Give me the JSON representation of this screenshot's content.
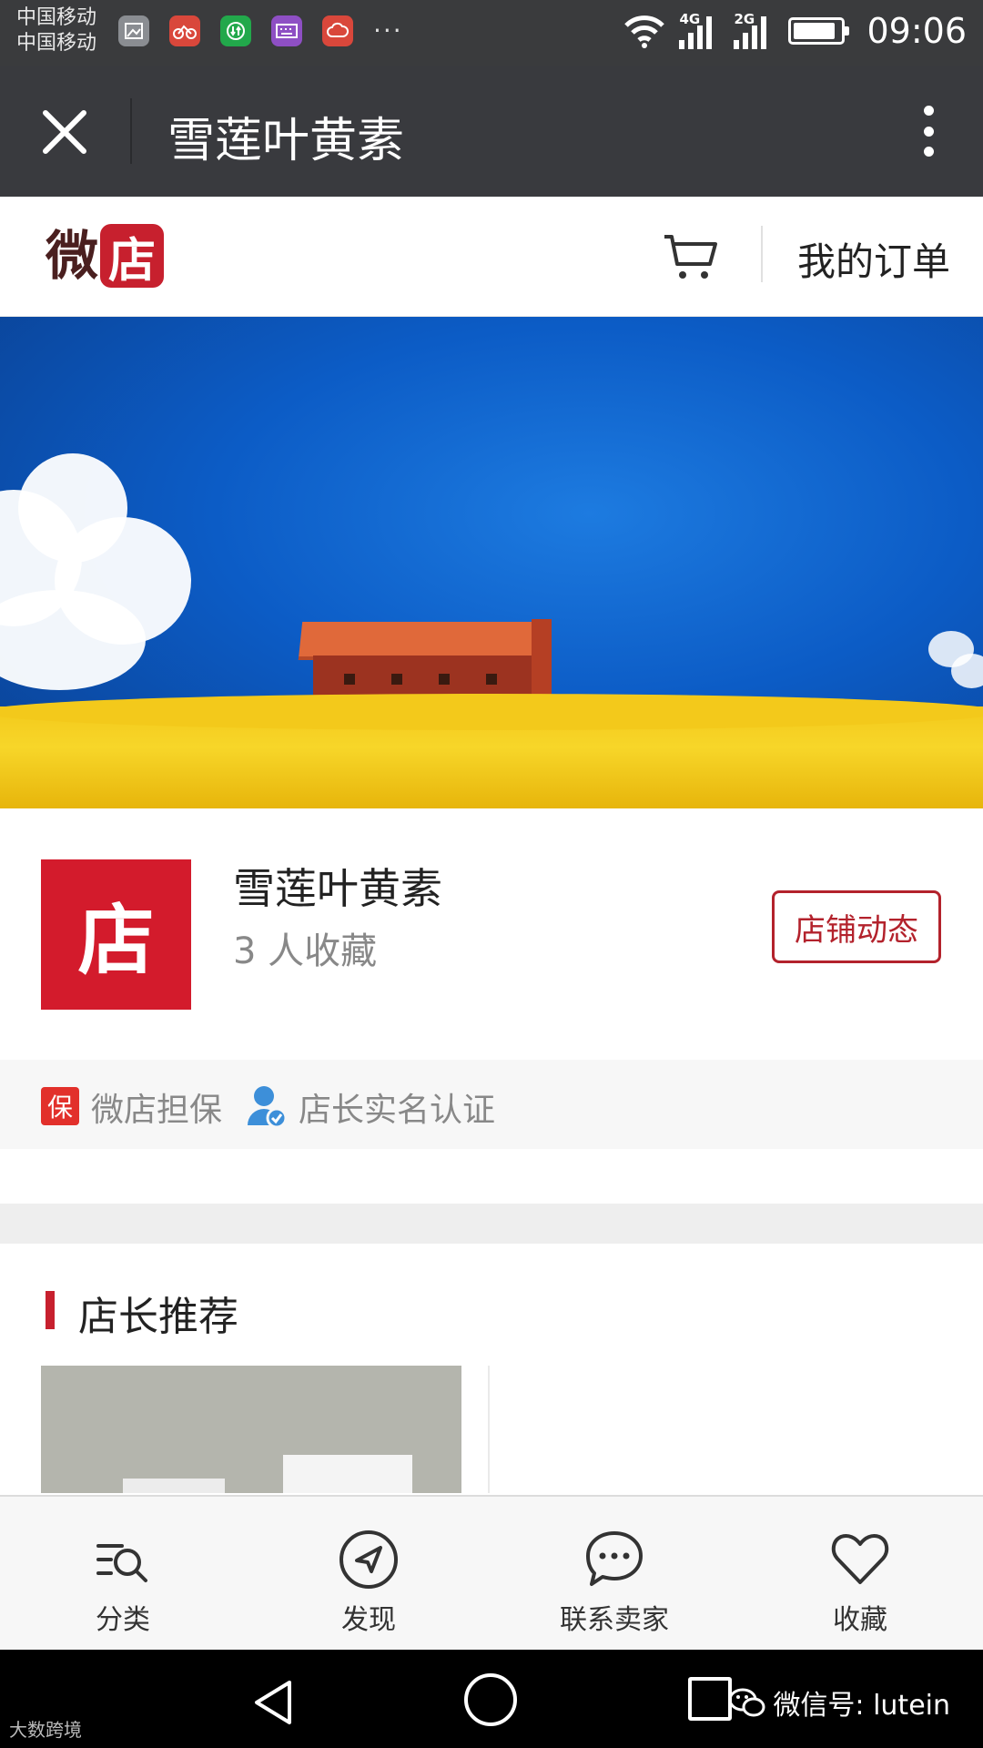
{
  "status_bar": {
    "carrier_1": "中国移动",
    "carrier_2": "中国移动",
    "network_1": "4G",
    "network_2": "2G",
    "time": "09:06",
    "more": "···",
    "battery_level": 0.9,
    "app_icons": [
      {
        "name": "gallery-icon",
        "color": "#8a8d92"
      },
      {
        "name": "bike-icon",
        "color": "#d9473b"
      },
      {
        "name": "download-icon",
        "color": "#22a84b"
      },
      {
        "name": "keyboard-icon",
        "color": "#8e4fc4"
      },
      {
        "name": "cloud-icon",
        "color": "#d9473b"
      }
    ]
  },
  "title_bar": {
    "title": "雪莲叶黄素",
    "close_icon": "close-icon",
    "more_icon": "more-vertical-icon"
  },
  "shop_header": {
    "logo_part1": "微",
    "logo_part2": "店",
    "cart_icon": "cart-icon",
    "orders_label": "我的订单"
  },
  "shop_info": {
    "avatar_char": "店",
    "name": "雪莲叶黄素",
    "favorites": "3 人收藏",
    "news_button": "店铺动态"
  },
  "guarantee": {
    "badge": "保",
    "item1": "微店担保",
    "item2": "店长实名认证"
  },
  "recommend": {
    "title": "店长推荐"
  },
  "bottom_nav": {
    "items": [
      {
        "label": "分类",
        "icon": "category-search-icon"
      },
      {
        "label": "发现",
        "icon": "compass-icon"
      },
      {
        "label": "联系卖家",
        "icon": "chat-icon"
      },
      {
        "label": "收藏",
        "icon": "heart-icon"
      }
    ]
  },
  "watermark": {
    "left": "大数跨境",
    "right": "微信号: lutein"
  },
  "colors": {
    "brand_red": "#c7202e",
    "title_bar_bg": "#393a3e",
    "status_bar_bg": "#3a3b3d"
  }
}
